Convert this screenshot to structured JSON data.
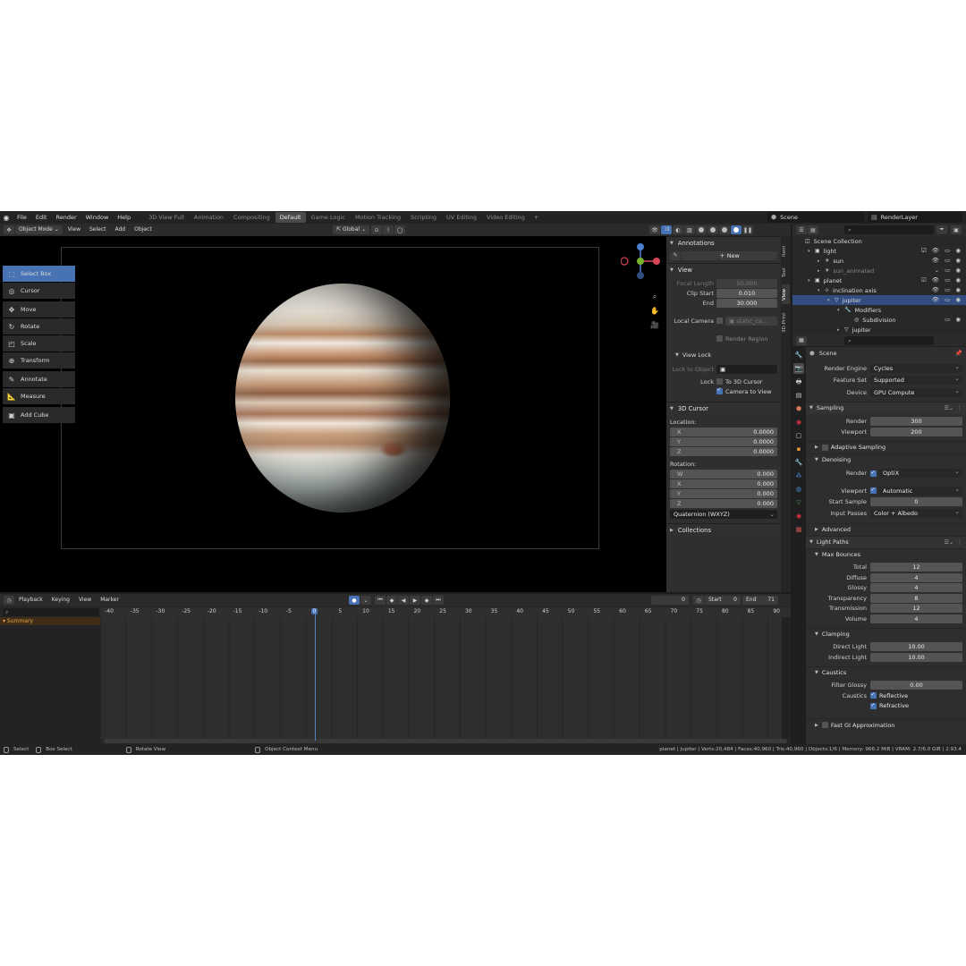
{
  "topbar": {
    "menus": [
      "File",
      "Edit",
      "Render",
      "Window",
      "Help"
    ],
    "workspaces": [
      {
        "label": "3D View Full",
        "active": false
      },
      {
        "label": "Animation",
        "active": false
      },
      {
        "label": "Compositing",
        "active": false
      },
      {
        "label": "Default",
        "active": true
      },
      {
        "label": "Game Logic",
        "active": false
      },
      {
        "label": "Motion Tracking",
        "active": false
      },
      {
        "label": "Scripting",
        "active": false
      },
      {
        "label": "UV Editing",
        "active": false
      },
      {
        "label": "Video Editing",
        "active": false
      }
    ],
    "add": "+",
    "scene": "Scene",
    "view_layer": "RenderLayer"
  },
  "vp_header": {
    "mode": "Object Mode",
    "menus": [
      "View",
      "Select",
      "Add",
      "Object"
    ],
    "orientation": "Global"
  },
  "toolbar": [
    {
      "label": "Select Box",
      "icon": "select-box-icon",
      "glyph": "⬚",
      "active": true,
      "gap": false
    },
    {
      "label": "Cursor",
      "icon": "cursor-icon",
      "glyph": "◎",
      "active": false,
      "gap": false
    },
    {
      "label": "Move",
      "icon": "move-icon",
      "glyph": "✥",
      "active": false,
      "gap": true
    },
    {
      "label": "Rotate",
      "icon": "rotate-icon",
      "glyph": "↻",
      "active": false,
      "gap": false
    },
    {
      "label": "Scale",
      "icon": "scale-icon",
      "glyph": "◰",
      "active": false,
      "gap": false
    },
    {
      "label": "Transform",
      "icon": "transform-icon",
      "glyph": "⊕",
      "active": false,
      "gap": false
    },
    {
      "label": "Annotate",
      "icon": "annotate-icon",
      "glyph": "✎",
      "active": false,
      "gap": true
    },
    {
      "label": "Measure",
      "icon": "measure-icon",
      "glyph": "📐",
      "active": false,
      "gap": false
    },
    {
      "label": "Add Cube",
      "icon": "add-cube-icon",
      "glyph": "▣",
      "active": false,
      "gap": true
    }
  ],
  "npanel": {
    "annotations": {
      "title": "Annotations",
      "new": "New"
    },
    "view": {
      "title": "View",
      "focal_label": "Focal Length",
      "focal_value": "50.000",
      "clip_start_label": "Clip Start",
      "clip_start_value": "0.010",
      "end_label": "End",
      "end_value": "30.000",
      "local_camera_label": "Local Camera",
      "local_camera_value": "static_ca...",
      "render_region": "Render Region",
      "view_lock": "View Lock",
      "lock_to_object": "Lock to Object",
      "lock_label": "Lock",
      "to_3d_cursor": "To 3D Cursor",
      "camera_to_view": "Camera to View"
    },
    "cursor": {
      "title": "3D Cursor",
      "location": "Location:",
      "loc": [
        {
          "axis": "X",
          "value": "0.0000"
        },
        {
          "axis": "Y",
          "value": "0.0000"
        },
        {
          "axis": "Z",
          "value": "0.0000"
        }
      ],
      "rotation": "Rotation:",
      "rot": [
        {
          "axis": "W",
          "value": "0.000"
        },
        {
          "axis": "X",
          "value": "0.000"
        },
        {
          "axis": "Y",
          "value": "0.000"
        },
        {
          "axis": "Z",
          "value": "0.000"
        }
      ],
      "mode": "Quaternion (WXYZ)"
    },
    "collections": "Collections",
    "tabs": [
      "Item",
      "Tool",
      "View",
      "3D-Print"
    ]
  },
  "timeline": {
    "menus": [
      "Playback",
      "Keying",
      "View",
      "Marker"
    ],
    "current_frame": "0",
    "start_label": "Start",
    "start": "0",
    "end_label": "End",
    "end": "71",
    "summary": "Summary",
    "ticks": [
      "-40",
      "-35",
      "-30",
      "-25",
      "-20",
      "-15",
      "-10",
      "-5",
      "0",
      "5",
      "10",
      "15",
      "20",
      "25",
      "30",
      "35",
      "40",
      "45",
      "50",
      "55",
      "60",
      "65",
      "70",
      "75",
      "80",
      "85",
      "90"
    ],
    "current_tick": "0"
  },
  "status": {
    "select": "Select",
    "box_select": "Box Select",
    "rotate_view": "Rotate View",
    "context_menu": "Object Context Menu",
    "info": "planet | jupiter | Verts:20,484 | Faces:40,960 | Tris:40,960 | Objects:1/6 | Memory: 966.2 MiB | VRAM: 2.7/6.0 GiB | 2.93.4"
  },
  "outliner": {
    "rows": [
      {
        "label": "Scene Collection",
        "indent": 0,
        "arrow": "",
        "icon": "◫",
        "sel": false,
        "dim": false,
        "right": ""
      },
      {
        "label": "light",
        "indent": 1,
        "arrow": "▾",
        "icon": "▣",
        "sel": false,
        "dim": false,
        "right": "☑ 👁 ▭ ◉"
      },
      {
        "label": "sun",
        "indent": 2,
        "arrow": "▸",
        "icon": "☀",
        "sel": false,
        "dim": false,
        "right": "👁 ▭ ◉"
      },
      {
        "label": "sun_animated",
        "indent": 2,
        "arrow": "▸",
        "icon": "☀",
        "sel": false,
        "dim": true,
        "right": "⌄ ▭ ◉"
      },
      {
        "label": "planet",
        "indent": 1,
        "arrow": "▾",
        "icon": "▣",
        "sel": false,
        "dim": false,
        "right": "☑ 👁 ▭ ◉"
      },
      {
        "label": "inclination axis",
        "indent": 2,
        "arrow": "▾",
        "icon": "⊹",
        "sel": false,
        "dim": false,
        "right": "👁 ▭ ◉"
      },
      {
        "label": "jupiter",
        "indent": 3,
        "arrow": "▾",
        "icon": "▽",
        "sel": true,
        "dim": false,
        "right": "👁 ▭ ◉"
      },
      {
        "label": "Modifiers",
        "indent": 4,
        "arrow": "▾",
        "icon": "🔧",
        "sel": false,
        "dim": false,
        "right": ""
      },
      {
        "label": "Subdivision",
        "indent": 5,
        "arrow": "",
        "icon": "◎",
        "sel": false,
        "dim": false,
        "right": "▭ ◉"
      },
      {
        "label": "jupiter",
        "indent": 4,
        "arrow": "▸",
        "icon": "▽",
        "sel": false,
        "dim": false,
        "right": ""
      }
    ]
  },
  "properties": {
    "context": "Scene",
    "render_engine_label": "Render Engine",
    "render_engine": "Cycles",
    "feature_set_label": "Feature Set",
    "feature_set": "Supported",
    "device_label": "Device",
    "device": "GPU Compute",
    "sampling": "Sampling",
    "render_label": "Render",
    "render_samples": "300",
    "viewport_label": "Viewport",
    "viewport_samples": "200",
    "adaptive": "Adaptive Sampling",
    "denoising": "Denoising",
    "den_render_label": "Render",
    "den_render": "OptiX",
    "den_viewport_label": "Viewport",
    "den_viewport": "Automatic",
    "start_sample_label": "Start Sample",
    "start_sample": "0",
    "input_passes_label": "Input Passes",
    "input_passes": "Color + Albedo",
    "advanced": "Advanced",
    "light_paths": "Light Paths",
    "max_bounces": "Max Bounces",
    "bounces": [
      {
        "label": "Total",
        "value": "12"
      },
      {
        "label": "Diffuse",
        "value": "4"
      },
      {
        "label": "Glossy",
        "value": "4"
      },
      {
        "label": "Transparency",
        "value": "8"
      },
      {
        "label": "Transmission",
        "value": "12"
      },
      {
        "label": "Volume",
        "value": "4"
      }
    ],
    "clamping": "Clamping",
    "direct_label": "Direct Light",
    "direct": "10.00",
    "indirect_label": "Indirect Light",
    "indirect": "10.00",
    "caustics": "Caustics",
    "filter_glossy_label": "Filter Glossy",
    "filter_glossy": "0.00",
    "caustics_label": "Caustics",
    "reflective": "Reflective",
    "refractive": "Refractive",
    "fast_gi": "Fast GI Approximation"
  },
  "colors": {
    "accent": "#4772b3",
    "selected_row": "#334d80",
    "summary": "#e8a649"
  }
}
